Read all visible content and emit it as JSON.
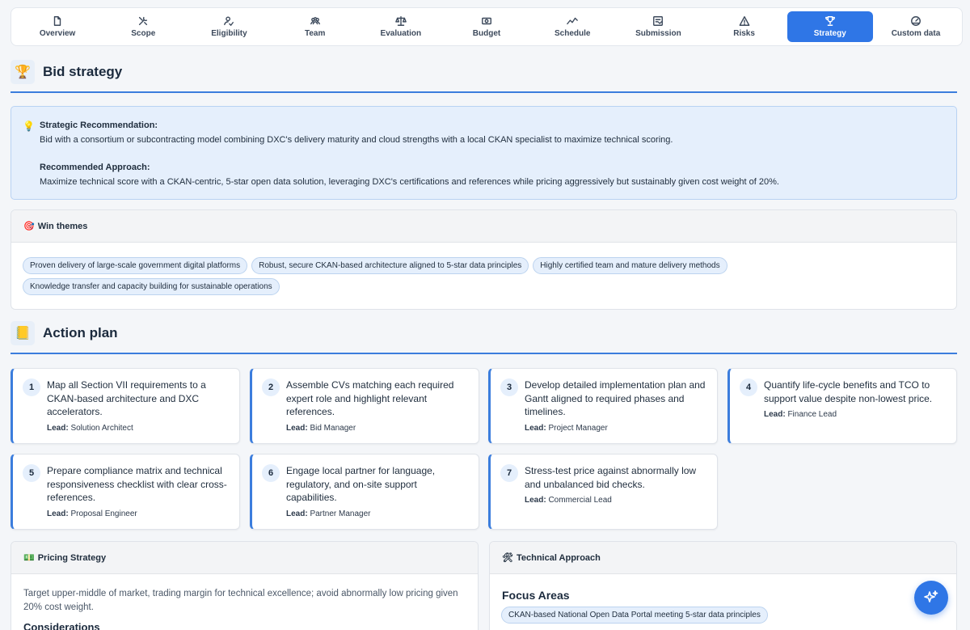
{
  "tabs": [
    {
      "label": "Overview",
      "icon": "document-icon"
    },
    {
      "label": "Scope",
      "icon": "tools-icon"
    },
    {
      "label": "Eligibility",
      "icon": "user-check-icon"
    },
    {
      "label": "Team",
      "icon": "team-icon"
    },
    {
      "label": "Evaluation",
      "icon": "scale-icon"
    },
    {
      "label": "Budget",
      "icon": "money-icon"
    },
    {
      "label": "Schedule",
      "icon": "trend-icon"
    },
    {
      "label": "Submission",
      "icon": "submission-icon"
    },
    {
      "label": "Risks",
      "icon": "warning-icon"
    },
    {
      "label": "Strategy",
      "icon": "trophy-icon",
      "active": true
    },
    {
      "label": "Custom data",
      "icon": "gauge-icon"
    }
  ],
  "bid_strategy": {
    "title": "Bid strategy",
    "icon": "🏆",
    "recommendation_label": "Strategic Recommendation:",
    "recommendation_text": "Bid with a consortium or subcontracting model combining DXC's delivery maturity and cloud strengths with a local CKAN specialist to maximize technical scoring.",
    "approach_label": "Recommended Approach:",
    "approach_text": "Maximize technical score with a CKAN-centric, 5-star open data solution, leveraging DXC's certifications and references while pricing aggressively but sustainably given cost weight of 20%."
  },
  "win_themes": {
    "title": "Win themes",
    "icon": "🎯",
    "items": [
      "Proven delivery of large-scale government digital platforms",
      "Robust, secure CKAN-based architecture aligned to 5-star data principles",
      "Highly certified team and mature delivery methods",
      "Knowledge transfer and capacity building for sustainable operations"
    ]
  },
  "action_plan": {
    "title": "Action plan",
    "icon": "📒",
    "lead_label": "Lead:",
    "items": [
      {
        "num": "1",
        "text": "Map all Section VII requirements to a CKAN-based architecture and DXC accelerators.",
        "lead": "Solution Architect"
      },
      {
        "num": "2",
        "text": "Assemble CVs matching each required expert role and highlight relevant references.",
        "lead": "Bid Manager"
      },
      {
        "num": "3",
        "text": "Develop detailed implementation plan and Gantt aligned to required phases and timelines.",
        "lead": "Project Manager"
      },
      {
        "num": "4",
        "text": "Quantify life-cycle benefits and TCO to support value despite non-lowest price.",
        "lead": "Finance Lead"
      },
      {
        "num": "5",
        "text": "Prepare compliance matrix and technical responsiveness checklist with clear cross-references.",
        "lead": "Proposal Engineer"
      },
      {
        "num": "6",
        "text": "Engage local partner for language, regulatory, and on-site support capabilities.",
        "lead": "Partner Manager"
      },
      {
        "num": "7",
        "text": "Stress-test price against abnormally low and unbalanced bid checks.",
        "lead": "Commercial Lead"
      }
    ]
  },
  "pricing": {
    "title": "Pricing Strategy",
    "icon": "💵",
    "text": "Target upper-middle of market, trading margin for technical excellence; avoid abnormally low pricing given 20% cost weight.",
    "considerations_label": "Considerations"
  },
  "technical": {
    "title": "Technical Approach",
    "icon": "🛠",
    "focus_label": "Focus Areas",
    "focus_items": [
      "CKAN-based National Open Data Portal meeting 5-star data principles"
    ]
  },
  "colors": {
    "accent": "#2f76e6",
    "rule": "#3b7ddd",
    "chip_bg": "#e5effc"
  }
}
